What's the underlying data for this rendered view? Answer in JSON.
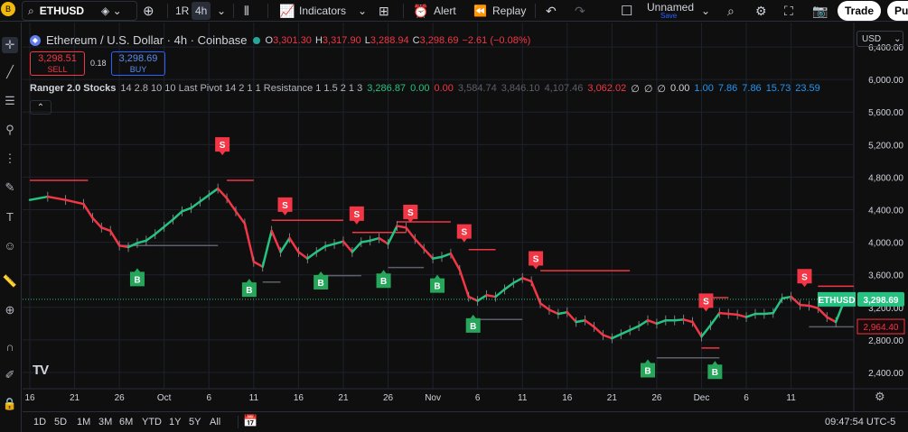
{
  "topbar": {
    "avatar_label": "B",
    "symbol": "ETHUSD",
    "interval_1r": "1R",
    "interval_4h": "4h",
    "indicators_label": "Indicators",
    "alert_label": "Alert",
    "replay_label": "Replay",
    "layout_name": "Unnamed",
    "layout_save": "Save",
    "trade_label": "Trade",
    "publish_label": "Pu"
  },
  "legend": {
    "title": "Ethereum / U.S. Dollar · 4h · Coinbase",
    "o_label": "O",
    "o": "3,301.30",
    "h_label": "H",
    "h": "3,317.90",
    "l_label": "L",
    "l": "3,288.94",
    "c_label": "C",
    "c": "3,298.69",
    "change": "−2.61 (−0.08%)"
  },
  "order": {
    "sell_price": "3,298.51",
    "sell_label": "SELL",
    "spread": "0.18",
    "buy_price": "3,298.69",
    "buy_label": "BUY"
  },
  "indicator": {
    "name": "Ranger 2.0 Stocks",
    "params": "14 2.8 10 10 Last Pivot 14 2 1 1 Resistance 1 1.5 2 1 3",
    "values": [
      {
        "text": "3,286.87",
        "color": "#26c281"
      },
      {
        "text": "0.00",
        "color": "#26c281"
      },
      {
        "text": "0.00",
        "color": "#f23645"
      },
      {
        "text": "3,584.74",
        "color": "#5d606b"
      },
      {
        "text": "3,846.10",
        "color": "#5d606b"
      },
      {
        "text": "4,107.46",
        "color": "#5d606b"
      },
      {
        "text": "3,062.02",
        "color": "#f23645"
      },
      {
        "text": "∅",
        "color": "#d1d4dc"
      },
      {
        "text": "∅",
        "color": "#d1d4dc"
      },
      {
        "text": "∅",
        "color": "#d1d4dc"
      },
      {
        "text": "0.00",
        "color": "#d1d4dc"
      },
      {
        "text": "1.00",
        "color": "#2196f3"
      },
      {
        "text": "7.86",
        "color": "#2196f3"
      },
      {
        "text": "7.86",
        "color": "#2196f3"
      },
      {
        "text": "15.73",
        "color": "#2196f3"
      },
      {
        "text": "23.59",
        "color": "#2196f3"
      }
    ]
  },
  "currency": "USD",
  "chart_data": {
    "type": "line",
    "title": "Ethereum / U.S. Dollar · 4h · Coinbase",
    "ylim": [
      2200,
      6700
    ],
    "y_ticks": [
      "6,400.00",
      "6,000.00",
      "5,600.00",
      "5,200.00",
      "4,800.00",
      "4,400.00",
      "4,000.00",
      "3,600.00",
      "3,200.00",
      "2,800.00",
      "2,400.00"
    ],
    "y_tick_values": [
      6400,
      6000,
      5600,
      5200,
      4800,
      4400,
      4000,
      3600,
      3200,
      2800,
      2400
    ],
    "x_ticks": [
      "16",
      "21",
      "26",
      "Oct",
      "6",
      "11",
      "16",
      "21",
      "26",
      "Nov",
      "6",
      "11",
      "16",
      "21",
      "26",
      "Dec",
      "6",
      "11"
    ],
    "x_tick_pos": [
      0,
      5,
      10,
      15,
      20,
      25,
      30,
      35,
      40,
      45,
      50,
      55,
      60,
      65,
      70,
      75,
      80,
      85
    ],
    "x_range": [
      0,
      92
    ],
    "price": [
      [
        0,
        4520
      ],
      [
        2,
        4560
      ],
      [
        4,
        4520
      ],
      [
        6,
        4470
      ],
      [
        7,
        4300
      ],
      [
        8,
        4180
      ],
      [
        9,
        4140
      ],
      [
        10,
        3960
      ],
      [
        11,
        3940
      ],
      [
        12,
        3990
      ],
      [
        13,
        4020
      ],
      [
        14,
        4100
      ],
      [
        15,
        4190
      ],
      [
        16,
        4280
      ],
      [
        17,
        4380
      ],
      [
        18,
        4420
      ],
      [
        19,
        4500
      ],
      [
        20,
        4580
      ],
      [
        21,
        4660
      ],
      [
        22,
        4540
      ],
      [
        23,
        4380
      ],
      [
        24,
        4230
      ],
      [
        25,
        3760
      ],
      [
        26,
        3700
      ],
      [
        27,
        4140
      ],
      [
        28,
        3880
      ],
      [
        29,
        4050
      ],
      [
        30,
        3880
      ],
      [
        31,
        3800
      ],
      [
        32,
        3880
      ],
      [
        33,
        3950
      ],
      [
        34,
        3980
      ],
      [
        35,
        4010
      ],
      [
        36,
        3880
      ],
      [
        37,
        4000
      ],
      [
        38,
        4020
      ],
      [
        39,
        4050
      ],
      [
        40,
        3980
      ],
      [
        41,
        4200
      ],
      [
        42,
        4180
      ],
      [
        43,
        4040
      ],
      [
        44,
        3920
      ],
      [
        45,
        3800
      ],
      [
        46,
        3820
      ],
      [
        47,
        3860
      ],
      [
        48,
        3660
      ],
      [
        49,
        3330
      ],
      [
        50,
        3280
      ],
      [
        51,
        3350
      ],
      [
        52,
        3330
      ],
      [
        53,
        3420
      ],
      [
        54,
        3500
      ],
      [
        55,
        3560
      ],
      [
        56,
        3520
      ],
      [
        57,
        3250
      ],
      [
        58,
        3170
      ],
      [
        59,
        3120
      ],
      [
        60,
        3140
      ],
      [
        61,
        3020
      ],
      [
        62,
        3040
      ],
      [
        63,
        2960
      ],
      [
        64,
        2860
      ],
      [
        65,
        2820
      ],
      [
        66,
        2870
      ],
      [
        67,
        2920
      ],
      [
        68,
        2970
      ],
      [
        69,
        3040
      ],
      [
        70,
        3000
      ],
      [
        71,
        3040
      ],
      [
        72,
        3040
      ],
      [
        73,
        3050
      ],
      [
        74,
        3020
      ],
      [
        75,
        2840
      ],
      [
        76,
        2980
      ],
      [
        77,
        3130
      ],
      [
        78,
        3120
      ],
      [
        79,
        3110
      ],
      [
        80,
        3080
      ],
      [
        81,
        3120
      ],
      [
        82,
        3120
      ],
      [
        83,
        3130
      ],
      [
        84,
        3310
      ],
      [
        85,
        3330
      ],
      [
        86,
        3230
      ],
      [
        87,
        3220
      ],
      [
        88,
        3190
      ],
      [
        89,
        3080
      ],
      [
        90,
        3020
      ],
      [
        91,
        3298.69
      ]
    ],
    "resistance_levels": [
      {
        "x1": 0,
        "x2": 6.5,
        "y": 4760
      },
      {
        "x1": 22,
        "x2": 25,
        "y": 4760
      },
      {
        "x1": 27,
        "x2": 35,
        "y": 4270
      },
      {
        "x1": 36,
        "x2": 42,
        "y": 4120
      },
      {
        "x1": 41,
        "x2": 47,
        "y": 4250
      },
      {
        "x1": 49,
        "x2": 52,
        "y": 3910
      },
      {
        "x1": 57,
        "x2": 67,
        "y": 3650
      },
      {
        "x1": 76,
        "x2": 78,
        "y": 3320
      },
      {
        "x1": 88,
        "x2": 92,
        "y": 3460
      },
      {
        "x1": 75,
        "x2": 77,
        "y": 2700
      }
    ],
    "support_levels": [
      {
        "x1": 10,
        "x2": 21,
        "y": 3960
      },
      {
        "x1": 26,
        "x2": 28,
        "y": 3510
      },
      {
        "x1": 32,
        "x2": 37,
        "y": 3590
      },
      {
        "x1": 40,
        "x2": 44,
        "y": 3690
      },
      {
        "x1": 49,
        "x2": 55,
        "y": 3050
      },
      {
        "x1": 70,
        "x2": 77,
        "y": 2580
      },
      {
        "x1": 87,
        "x2": 92,
        "y": 2960
      }
    ],
    "sell_signals": [
      {
        "x": 21.5,
        "y": 5180
      },
      {
        "x": 28.5,
        "y": 4440
      },
      {
        "x": 36.5,
        "y": 4330
      },
      {
        "x": 42.5,
        "y": 4350
      },
      {
        "x": 48.5,
        "y": 4110
      },
      {
        "x": 56.5,
        "y": 3780
      },
      {
        "x": 75.5,
        "y": 3260
      },
      {
        "x": 86.5,
        "y": 3560
      }
    ],
    "buy_signals": [
      {
        "x": 12,
        "y": 3570
      },
      {
        "x": 24.5,
        "y": 3440
      },
      {
        "x": 32.5,
        "y": 3530
      },
      {
        "x": 39.5,
        "y": 3550
      },
      {
        "x": 45.5,
        "y": 3490
      },
      {
        "x": 49.5,
        "y": 3000
      },
      {
        "x": 69,
        "y": 2450
      },
      {
        "x": 76.5,
        "y": 2430
      }
    ],
    "signal_labels": {
      "sell": "S",
      "buy": "B"
    },
    "last_price_label": "ETHUSD",
    "last_price": "3,298.69",
    "secondary_price": "2,964.40",
    "secondary_value": 2964.4
  },
  "bottombar": {
    "ranges": [
      "1D",
      "5D",
      "1M",
      "3M",
      "6M",
      "YTD",
      "1Y",
      "5Y",
      "All"
    ],
    "clock": "09:47:54 UTC-5"
  },
  "colors": {
    "up": "#26c281",
    "down": "#f23645",
    "sell_signal": "#f23645",
    "buy_signal": "#26a65b",
    "grid": "#1e222d",
    "accent": "#2962ff"
  }
}
